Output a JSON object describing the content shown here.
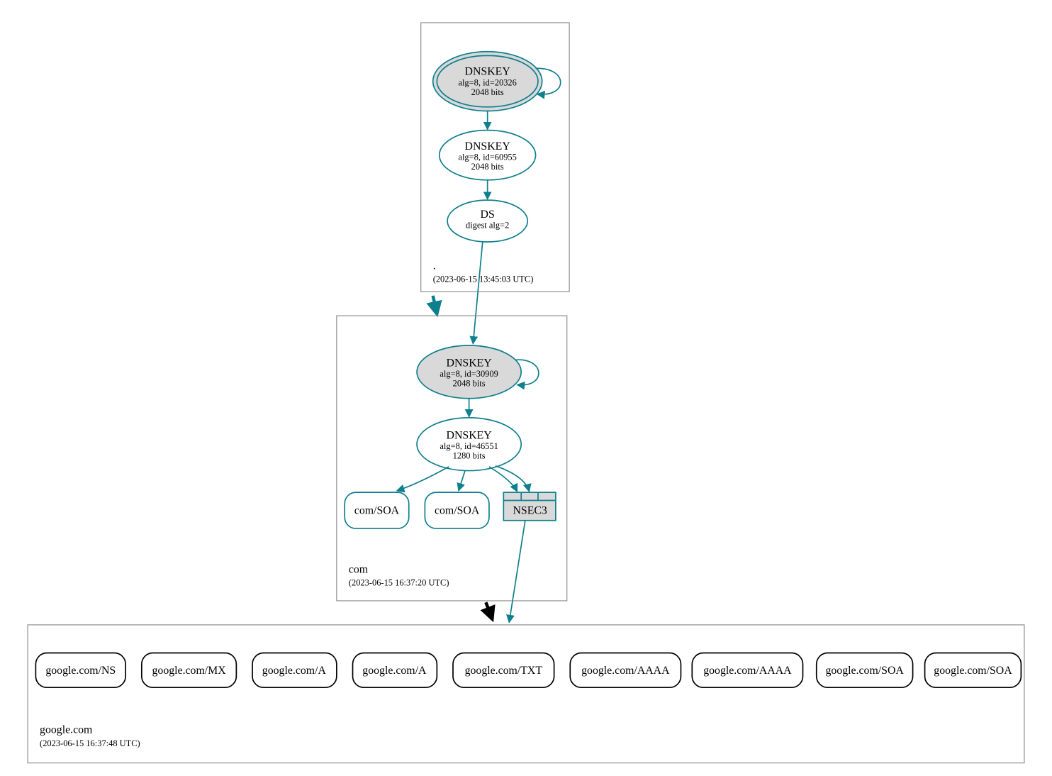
{
  "colors": {
    "teal": "#0e7f8c",
    "grey": "#d9d9d9"
  },
  "zones": {
    "root": {
      "name": ".",
      "timestamp": "(2023-06-15 13:45:03 UTC)"
    },
    "com": {
      "name": "com",
      "timestamp": "(2023-06-15 16:37:20 UTC)"
    },
    "google": {
      "name": "google.com",
      "timestamp": "(2023-06-15 16:37:48 UTC)"
    }
  },
  "nodes": {
    "root_ksk": {
      "title": "DNSKEY",
      "line2": "alg=8, id=20326",
      "line3": "2048 bits"
    },
    "root_zsk": {
      "title": "DNSKEY",
      "line2": "alg=8, id=60955",
      "line3": "2048 bits"
    },
    "root_ds": {
      "title": "DS",
      "line2": "digest alg=2"
    },
    "com_ksk": {
      "title": "DNSKEY",
      "line2": "alg=8, id=30909",
      "line3": "2048 bits"
    },
    "com_zsk": {
      "title": "DNSKEY",
      "line2": "alg=8, id=46551",
      "line3": "1280 bits"
    },
    "com_soa1": {
      "title": "com/SOA"
    },
    "com_soa2": {
      "title": "com/SOA"
    },
    "nsec3": {
      "title": "NSEC3"
    }
  },
  "records": {
    "r0": "google.com/NS",
    "r1": "google.com/MX",
    "r2": "google.com/A",
    "r3": "google.com/A",
    "r4": "google.com/TXT",
    "r5": "google.com/AAAA",
    "r6": "google.com/AAAA",
    "r7": "google.com/SOA",
    "r8": "google.com/SOA"
  }
}
